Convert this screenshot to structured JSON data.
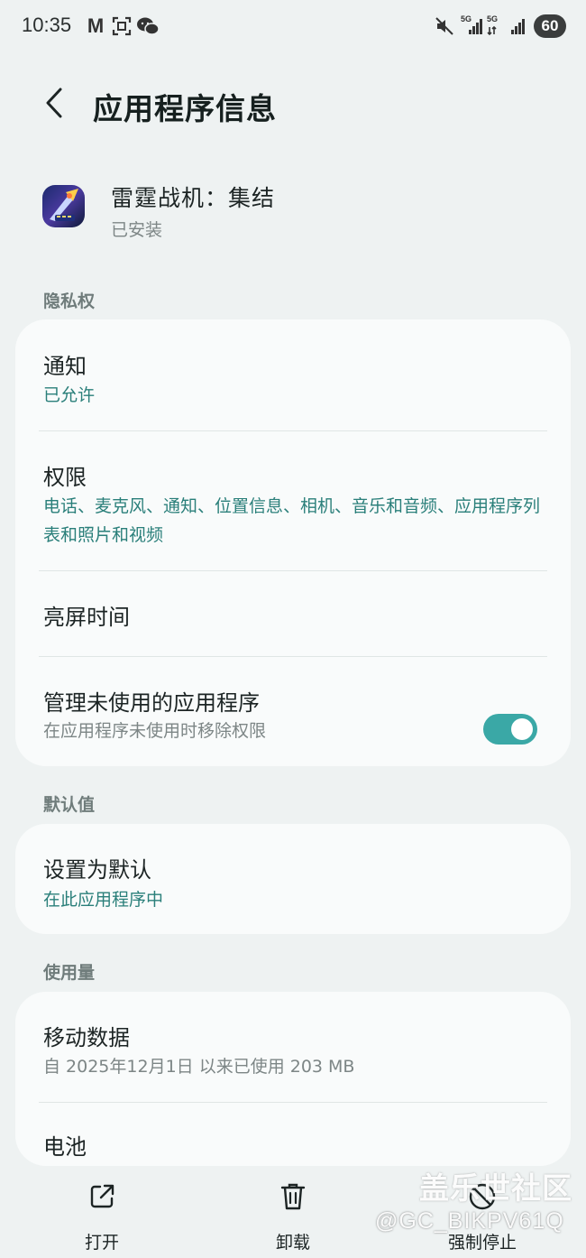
{
  "status_bar": {
    "time": "10:35",
    "battery": "60",
    "net1": "5G",
    "net2": "5G"
  },
  "header": {
    "title": "应用程序信息"
  },
  "app": {
    "name": "雷霆战机：集结",
    "status": "已安装"
  },
  "sections": {
    "privacy": "隐私权",
    "defaults": "默认值",
    "usage": "使用量"
  },
  "privacy_rows": {
    "notifications": {
      "title": "通知",
      "sub": "已允许"
    },
    "permissions": {
      "title": "权限",
      "sub": "电话、麦克风、通知、位置信息、相机、音乐和音频、应用程序列表和照片和视频"
    },
    "screen_time": {
      "title": "亮屏时间"
    },
    "manage_unused": {
      "title": "管理未使用的应用程序",
      "sub": "在应用程序未使用时移除权限",
      "enabled": true
    }
  },
  "default_rows": {
    "set_default": {
      "title": "设置为默认",
      "sub": "在此应用程序中"
    }
  },
  "usage_rows": {
    "mobile_data": {
      "title": "移动数据",
      "sub": "自 2025年12月1日 以来已使用 203 MB"
    },
    "battery": {
      "title": "电池"
    }
  },
  "bottom_actions": {
    "open": "打开",
    "uninstall": "卸载",
    "force_stop": "强制停止"
  },
  "watermark": {
    "logo": "盖乐世社区",
    "id": "@GC_BIKPV61Q"
  },
  "colors": {
    "accent": "#3aa8a6",
    "subtext_accent": "#2a7f7a",
    "background": "#eef2f2",
    "card": "#f9fbfb"
  }
}
